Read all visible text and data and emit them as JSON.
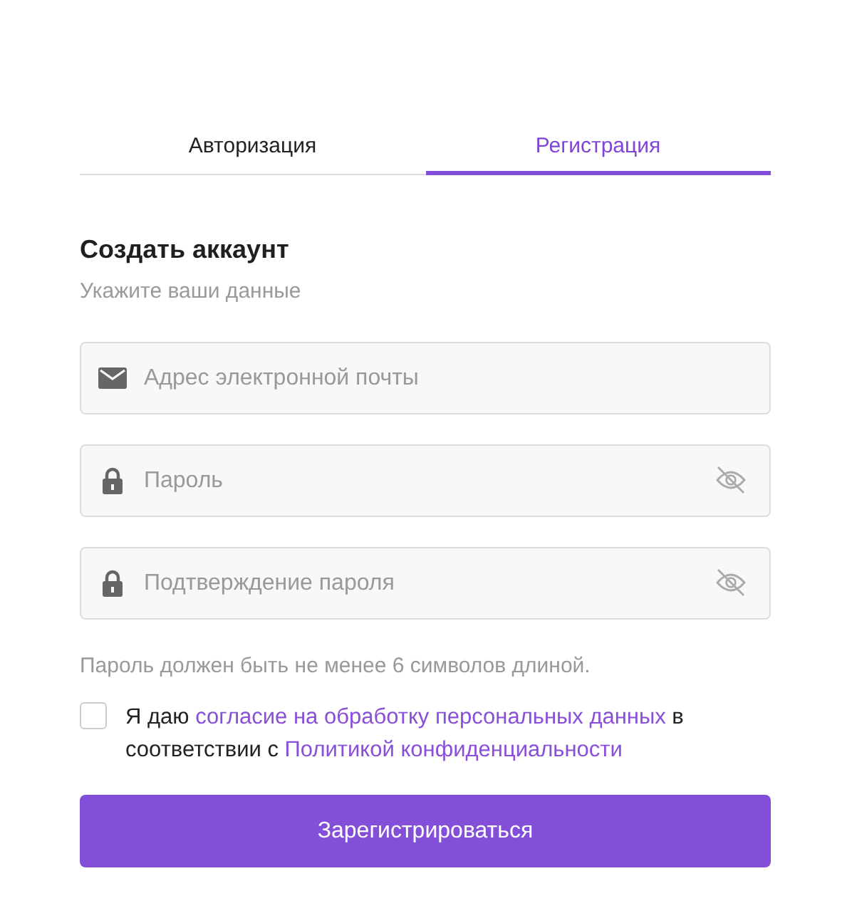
{
  "tabs": [
    {
      "label": "Авторизация",
      "selected": false
    },
    {
      "label": "Регистрация",
      "selected": true
    }
  ],
  "heading": "Создать аккаунт",
  "subheading": "Укажите ваши данные",
  "fields": [
    {
      "kind": "email",
      "placeholder": "Адрес электронной почты",
      "visibility_toggle": false
    },
    {
      "kind": "password",
      "placeholder": "Пароль",
      "visibility_toggle": true
    },
    {
      "kind": "password",
      "placeholder": "Подтверждение пароля",
      "visibility_toggle": true
    }
  ],
  "hint": "Пароль должен быть не менее 6 символов длиной.",
  "consent": {
    "checked": false,
    "parts": [
      {
        "kind": "text",
        "text": "Я даю "
      },
      {
        "kind": "link",
        "text": "согласие на обработку персональных данных"
      },
      {
        "kind": "text",
        "text": " в соответствии с "
      },
      {
        "kind": "link",
        "text": "Политикой конфиденциальности"
      }
    ]
  },
  "submit": "Зарегистрироваться"
}
